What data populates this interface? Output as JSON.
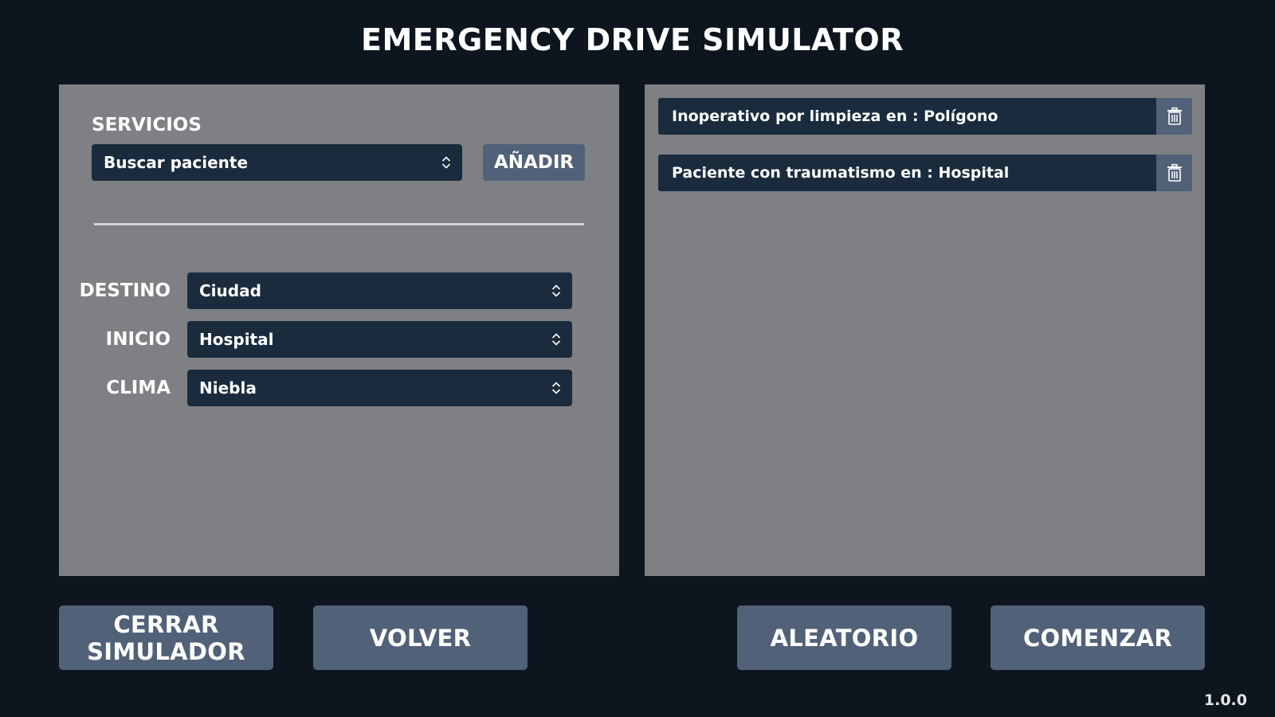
{
  "title": "EMERGENCY DRIVE SIMULATOR",
  "left_panel": {
    "services_label": "SERVICIOS",
    "services_select_value": "Buscar paciente",
    "add_button_label": "AÑADIR",
    "fields": {
      "destino": {
        "label": "DESTINO",
        "value": "Ciudad"
      },
      "inicio": {
        "label": "INICIO",
        "value": "Hospital"
      },
      "clima": {
        "label": "CLIMA",
        "value": "Niebla"
      }
    }
  },
  "right_panel": {
    "entries": [
      {
        "text": "Inoperativo por limpieza en : Polígono",
        "icon": "trash-icon"
      },
      {
        "text": "Paciente con traumatismo en : Hospital",
        "icon": "trash-icon"
      }
    ]
  },
  "buttons": {
    "close_line1": "CERRAR",
    "close_line2": "SIMULADOR",
    "back": "VOLVER",
    "random": "ALEATORIO",
    "start": "COMENZAR"
  },
  "version": "1.0.0",
  "colors": {
    "background": "#0d161f",
    "panel": "#7f8083",
    "select": "#1a2b3d",
    "button": "#516178",
    "text": "#ffffff"
  }
}
